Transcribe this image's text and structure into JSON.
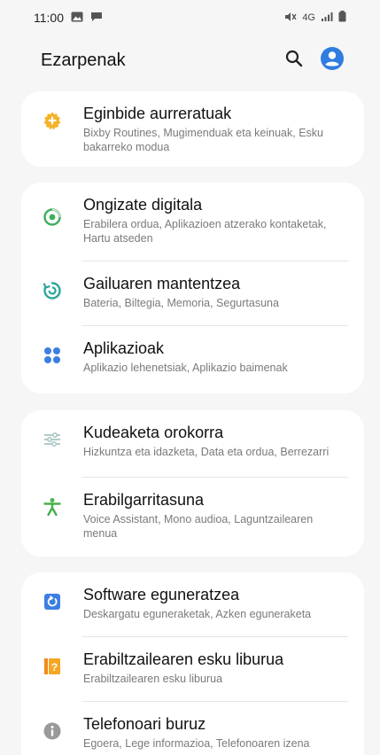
{
  "status_bar": {
    "time": "11:00",
    "network_label": "4G",
    "accent": "#2f7de1"
  },
  "header": {
    "title": "Ezarpenak"
  },
  "groups": [
    {
      "items": [
        {
          "title": "Eginbide aurreratuak",
          "subtitle": "Bixby Routines, Mugimenduak eta keinuak, Esku bakarreko modua",
          "icon": "gear-plus-icon"
        }
      ]
    },
    {
      "items": [
        {
          "title": "Ongizate digitala",
          "subtitle": "Erabilera ordua, Aplikazioen atzerako kontaketak, Hartu atseden",
          "icon": "wellbeing-icon"
        },
        {
          "title": "Gailuaren mantentzea",
          "subtitle": "Bateria, Biltegia, Memoria, Segurtasuna",
          "icon": "device-care-icon"
        },
        {
          "title": "Aplikazioak",
          "subtitle": "Aplikazio lehenetsiak, Aplikazio baimenak",
          "icon": "apps-icon"
        }
      ]
    },
    {
      "items": [
        {
          "title": "Kudeaketa orokorra",
          "subtitle": "Hizkuntza eta idazketa, Data eta ordua, Berrezarri",
          "icon": "sliders-icon"
        },
        {
          "title": "Erabilgarritasuna",
          "subtitle": "Voice Assistant, Mono audioa, Laguntzailearen menua",
          "icon": "accessibility-icon"
        }
      ]
    },
    {
      "items": [
        {
          "title": "Software eguneratzea",
          "subtitle": "Deskargatu eguneraketak, Azken eguneraketa",
          "icon": "update-icon"
        },
        {
          "title": "Erabiltzailearen esku liburua",
          "subtitle": "Erabiltzailearen esku liburua",
          "icon": "manual-icon"
        },
        {
          "title": "Telefonoari buruz",
          "subtitle": "Egoera, Lege informazioa, Telefonoaren izena",
          "icon": "info-icon"
        }
      ]
    }
  ]
}
